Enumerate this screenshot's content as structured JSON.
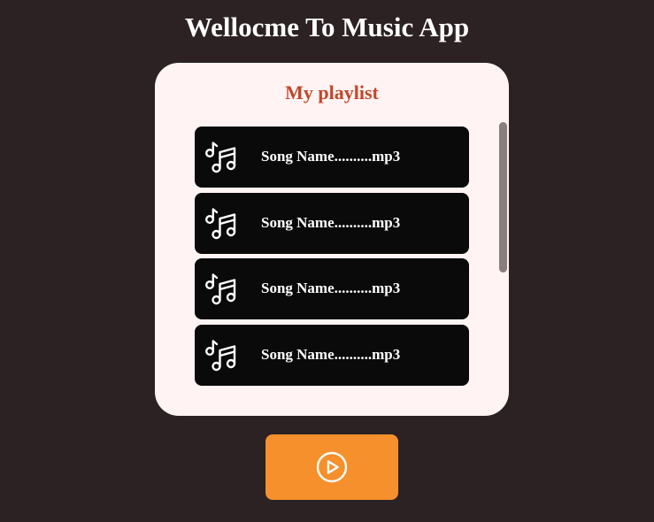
{
  "header": {
    "title": "Wellocme To Music App"
  },
  "playlist": {
    "title": "My playlist",
    "songs": [
      {
        "name": "Song Name..........mp3",
        "icon": "music-notes-icon"
      },
      {
        "name": "Song Name..........mp3",
        "icon": "music-notes-icon"
      },
      {
        "name": "Song Name..........mp3",
        "icon": "music-notes-icon"
      },
      {
        "name": "Song Name..........mp3",
        "icon": "music-notes-icon"
      }
    ]
  },
  "controls": {
    "play_icon": "play-circle-icon"
  },
  "colors": {
    "background": "#2c2123",
    "card": "#fff4f3",
    "accent_title": "#c2472b",
    "song_item": "#0a0a0a",
    "play_button": "#f5902c"
  }
}
